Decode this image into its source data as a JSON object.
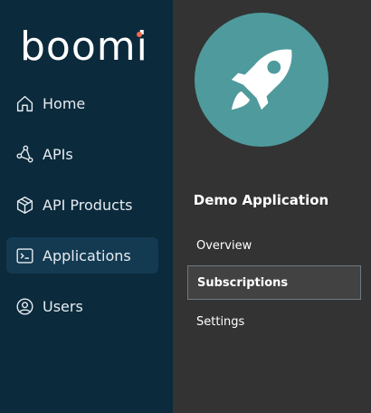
{
  "brand": {
    "logo_text": "boomi",
    "logo_dot_color": "#f26b4a"
  },
  "sidebar": {
    "items": [
      {
        "label": "Home",
        "icon": "home-icon",
        "active": false
      },
      {
        "label": "APIs",
        "icon": "api-nodes-icon",
        "active": false
      },
      {
        "label": "API Products",
        "icon": "box-icon",
        "active": false
      },
      {
        "label": "Applications",
        "icon": "terminal-icon",
        "active": true
      },
      {
        "label": "Users",
        "icon": "user-circle-icon",
        "active": false
      }
    ]
  },
  "application": {
    "name": "Demo Application",
    "avatar_icon": "rocket-icon",
    "avatar_color": "#4f9a9c"
  },
  "sub_nav": {
    "items": [
      {
        "label": "Overview",
        "selected": false
      },
      {
        "label": "Subscriptions",
        "selected": true
      },
      {
        "label": "Settings",
        "selected": false
      }
    ]
  },
  "colors": {
    "sidebar_bg": "#0b2a3c",
    "sidebar_active_bg": "#143a52",
    "main_bg": "#333333"
  }
}
